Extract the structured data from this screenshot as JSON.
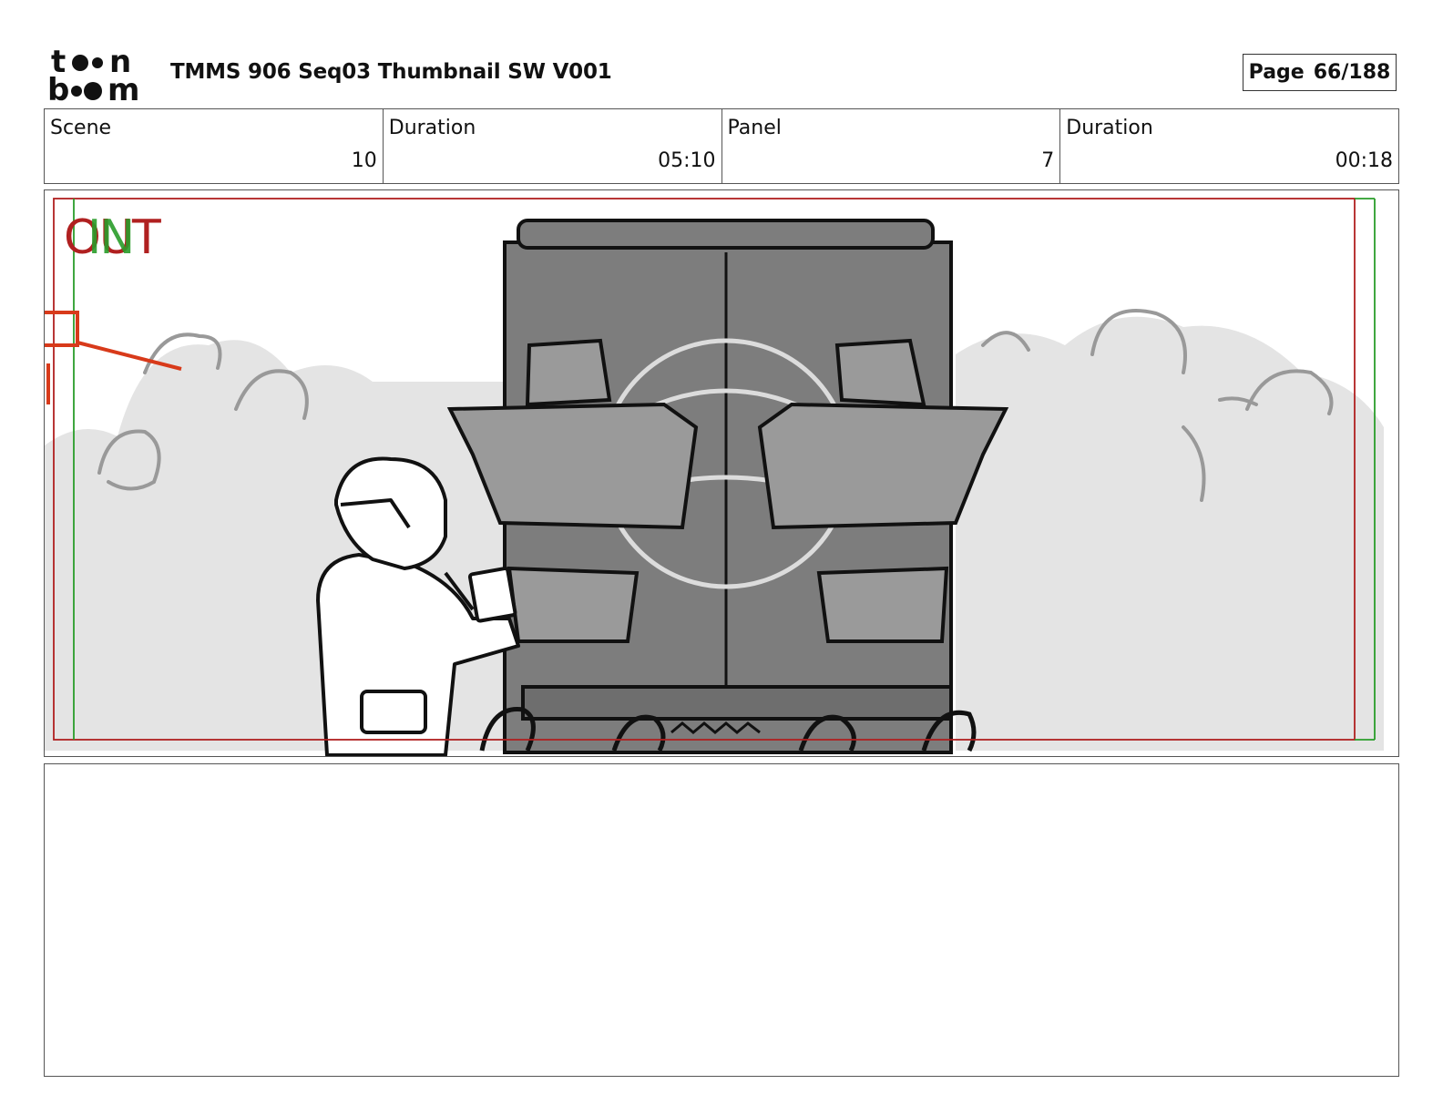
{
  "header": {
    "logo_text": "toon boom",
    "title": "TMMS 906 Seq03 Thumbnail SW V001",
    "page_label": "Page",
    "page_value": "66/188"
  },
  "info": {
    "scene_label": "Scene",
    "scene_value": "10",
    "scene_duration_label": "Duration",
    "scene_duration_value": "05:10",
    "panel_label": "Panel",
    "panel_value": "7",
    "panel_duration_label": "Duration",
    "panel_duration_value": "00:18"
  },
  "panel": {
    "in_label": "IN",
    "out_label": "OUT",
    "in_color": "#2a9d2a",
    "out_color": "#b02020"
  },
  "notes": {
    "text": ""
  }
}
